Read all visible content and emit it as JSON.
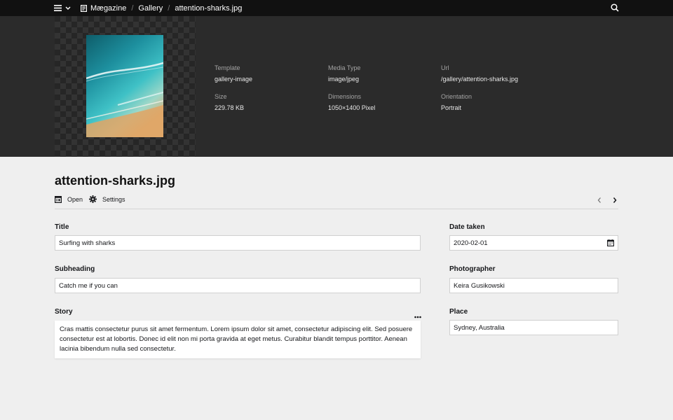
{
  "topbar": {
    "breadcrumbs": [
      {
        "label": "Mægazine"
      },
      {
        "label": "Gallery"
      },
      {
        "label": "attention-sharks.jpg"
      }
    ]
  },
  "header": {
    "info": [
      {
        "label": "Template",
        "value": "gallery-image"
      },
      {
        "label": "Media Type",
        "value": "image/jpeg"
      },
      {
        "label": "Url",
        "value": "/gallery/attention-sharks.jpg"
      },
      {
        "label": "Size",
        "value": "229.78 KB"
      },
      {
        "label": "Dimensions",
        "value": "1050×1400 Pixel"
      },
      {
        "label": "Orientation",
        "value": "Portrait"
      }
    ]
  },
  "page": {
    "title": "attention-sharks.jpg",
    "open_label": "Open",
    "settings_label": "Settings"
  },
  "fields": {
    "title": {
      "label": "Title",
      "value": "Surfing with sharks"
    },
    "subheading": {
      "label": "Subheading",
      "value": "Catch me if you can"
    },
    "story": {
      "label": "Story",
      "value": "Cras mattis consectetur purus sit amet fermentum. Lorem ipsum dolor sit amet, consectetur adipiscing elit. Sed posuere consectetur est at lobortis. Donec id elit non mi porta gravida at eget metus. Curabitur blandit tempus porttitor. Aenean lacinia bibendum nulla sed consectetur."
    },
    "date_taken": {
      "label": "Date taken",
      "value": "2020-02-01"
    },
    "photographer": {
      "label": "Photographer",
      "value": "Keira Gusikowski"
    },
    "place": {
      "label": "Place",
      "value": "Sydney, Australia"
    }
  },
  "colors": {
    "topbar": "#111111",
    "header": "#2b2b2b",
    "background": "#efefef"
  }
}
